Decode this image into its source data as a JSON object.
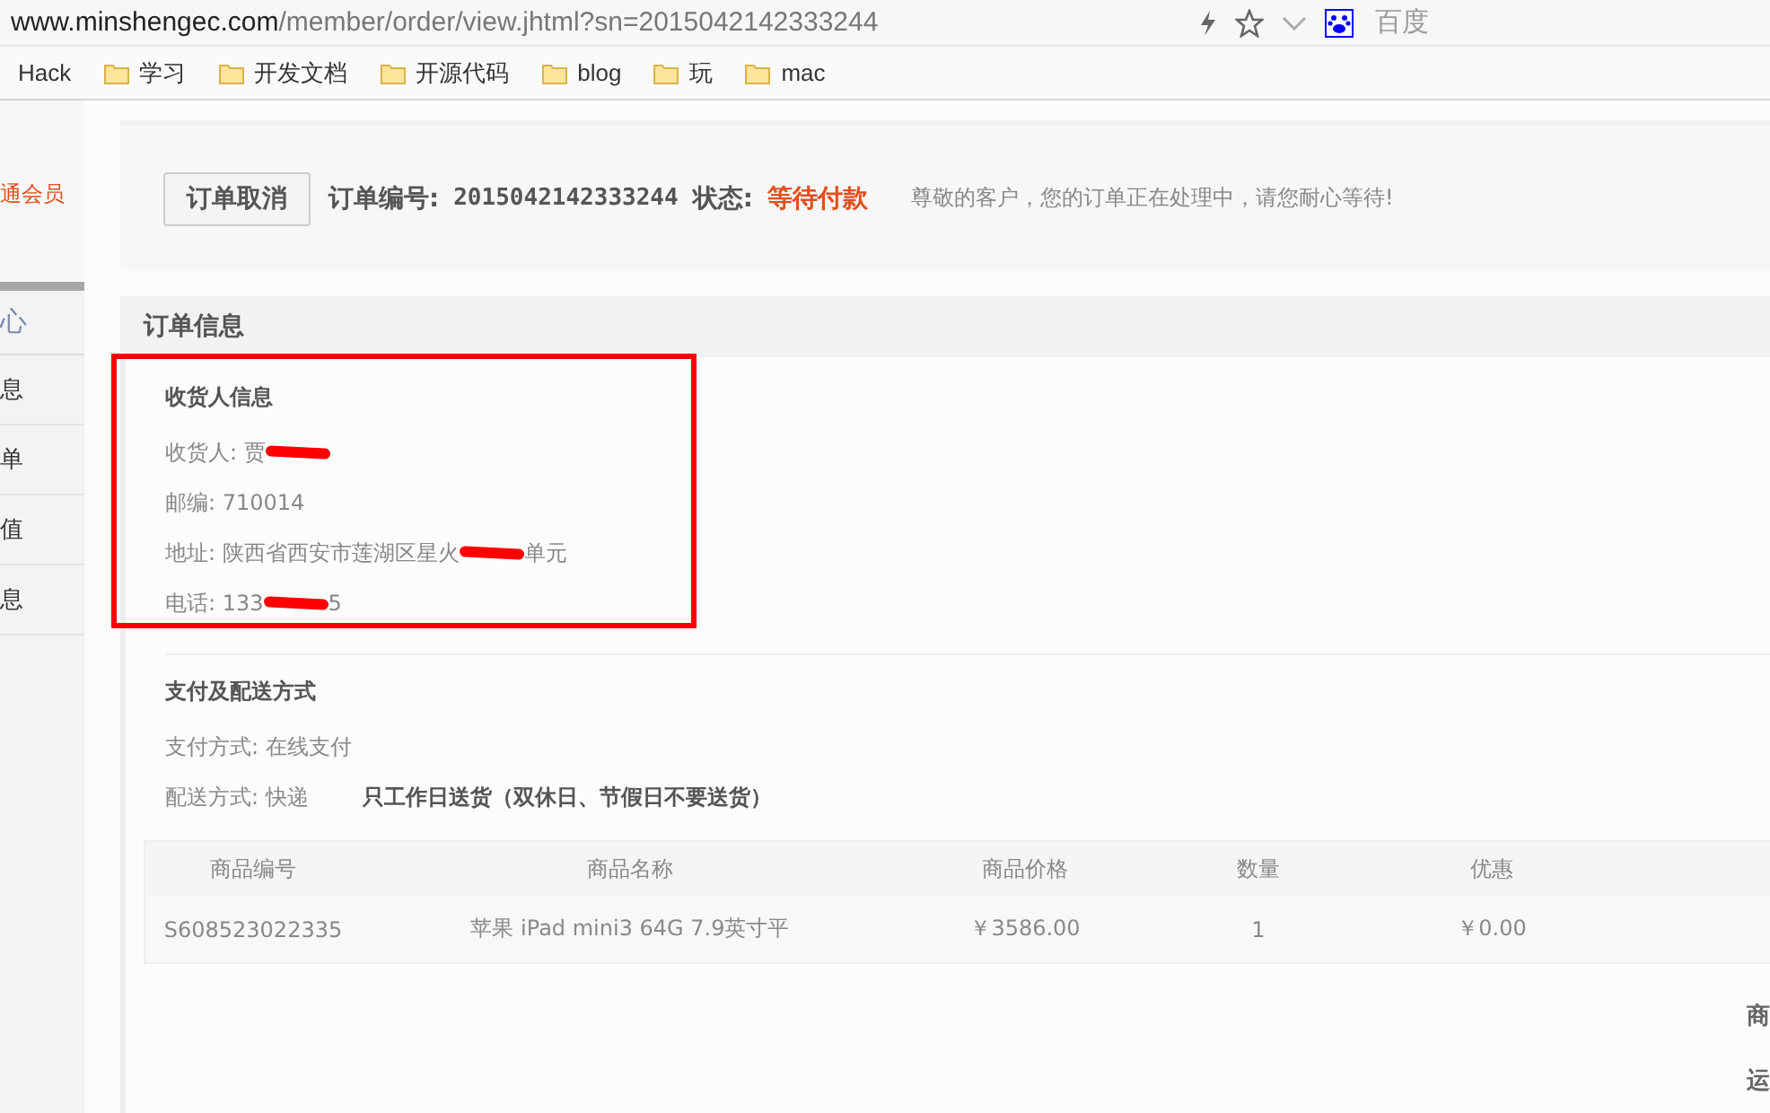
{
  "browser": {
    "url_host": "www.minshengec.com",
    "url_path": "/member/order/view.jhtml?sn=2015042142333244",
    "search_engine": "百度"
  },
  "bookmarks": [
    {
      "label": "Hack"
    },
    {
      "label": "学习"
    },
    {
      "label": "开发文档"
    },
    {
      "label": "开源代码"
    },
    {
      "label": "blog"
    },
    {
      "label": "玩"
    },
    {
      "label": "mac"
    }
  ],
  "sidebar": {
    "member_link": "通会员",
    "items": [
      {
        "label": "心",
        "kind": "heading"
      },
      {
        "label": "息",
        "kind": "item"
      },
      {
        "label": "单",
        "kind": "item"
      },
      {
        "label": "值",
        "kind": "item"
      },
      {
        "label": "息",
        "kind": "item"
      }
    ]
  },
  "order_bar": {
    "cancel_button": "订单取消",
    "number_label": "订单编号:",
    "number": "2015042142333244",
    "status_label": "状态:",
    "status": "等待付款",
    "notice": "尊敬的客户，您的订单正在处理中，请您耐心等待!"
  },
  "order_info": {
    "title": "订单信息",
    "consignee": {
      "title": "收货人信息",
      "lines": [
        {
          "before": "收货人: 贾",
          "redacted": true
        },
        {
          "before": "邮编: 710014",
          "redacted": false
        },
        {
          "before": "地址: 陕西省西安市莲湖区星火",
          "after": "单元",
          "redacted": true
        },
        {
          "before": "电话: 133",
          "after": "5",
          "redacted": true
        }
      ]
    },
    "shipping": {
      "title": "支付及配送方式",
      "payment": "支付方式: 在线支付",
      "delivery": "配送方式: 快递",
      "delivery_note": "只工作日送货（双休日、节假日不要送货）"
    },
    "table": {
      "columns": [
        "商品编号",
        "商品名称",
        "商品价格",
        "数量",
        "优惠"
      ],
      "rows": [
        [
          "S608523022335",
          "苹果 iPad mini3 64G 7.9英寸平",
          "￥3586.00",
          "1",
          "￥0.00"
        ]
      ]
    },
    "summary_labels": [
      "商",
      "运"
    ]
  }
}
